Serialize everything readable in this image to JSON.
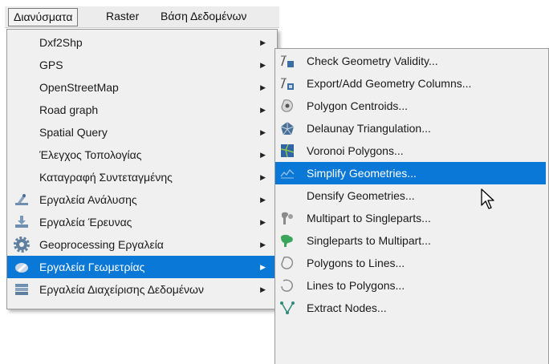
{
  "menubar": {
    "items": [
      {
        "label": "Διανύσματα"
      },
      {
        "label": "Raster"
      },
      {
        "label": "Βάση Δεδομένων"
      }
    ]
  },
  "vector_menu": {
    "items": [
      {
        "label": "Dxf2Shp",
        "icon": "none"
      },
      {
        "label": "GPS",
        "icon": "none"
      },
      {
        "label": "OpenStreetMap",
        "icon": "none"
      },
      {
        "label": "Road graph",
        "icon": "none"
      },
      {
        "label": "Spatial Query",
        "icon": "none"
      },
      {
        "label": "Έλεγχος Τοπολογίας",
        "icon": "none"
      },
      {
        "label": "Καταγραφή Συντεταγμένης",
        "icon": "none"
      },
      {
        "label": "Εργαλεία Ανάλυσης",
        "icon": "analysis-tools-icon"
      },
      {
        "label": "Εργαλεία Έρευνας",
        "icon": "research-tools-icon"
      },
      {
        "label": "Geoprocessing Εργαλεία",
        "icon": "geoprocessing-gear-icon"
      },
      {
        "label": "Εργαλεία Γεωμετρίας",
        "icon": "geometry-tools-icon",
        "selected": true
      },
      {
        "label": "Εργαλεία Διαχείρισης Δεδομένων",
        "icon": "data-management-icon"
      }
    ]
  },
  "geometry_submenu": {
    "items": [
      {
        "label": "Check Geometry Validity...",
        "icon": "check-geometry-icon"
      },
      {
        "label": "Export/Add Geometry Columns...",
        "icon": "export-geometry-columns-icon"
      },
      {
        "label": "Polygon Centroids...",
        "icon": "polygon-centroids-icon"
      },
      {
        "label": "Delaunay Triangulation...",
        "icon": "delaunay-icon"
      },
      {
        "label": "Voronoi Polygons...",
        "icon": "voronoi-icon"
      },
      {
        "label": "Simplify Geometries...",
        "icon": "simplify-icon",
        "selected": true
      },
      {
        "label": "Densify Geometries...",
        "icon": "none"
      },
      {
        "label": "Multipart to Singleparts...",
        "icon": "multipart-to-singleparts-icon"
      },
      {
        "label": "Singleparts to Multipart...",
        "icon": "singleparts-to-multipart-icon"
      },
      {
        "label": "Polygons to Lines...",
        "icon": "polygons-to-lines-icon"
      },
      {
        "label": "Lines to Polygons...",
        "icon": "lines-to-polygons-icon"
      },
      {
        "label": "Extract Nodes...",
        "icon": "extract-nodes-icon"
      }
    ]
  },
  "colors": {
    "selection": "#0a78d7",
    "menu_background": "#f0f0f0"
  }
}
